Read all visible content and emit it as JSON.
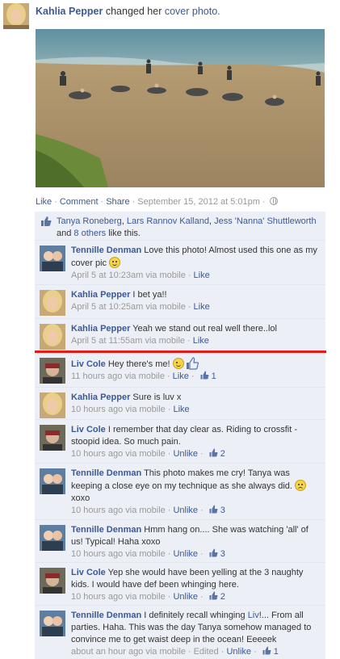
{
  "story": {
    "author": "Kahlia Pepper",
    "verb": "changed her",
    "object": "cover photo."
  },
  "actions": {
    "like": "Like",
    "comment": "Comment",
    "share": "Share",
    "timestamp": "September 15, 2012 at 5:01pm",
    "separator": "·"
  },
  "likes": {
    "names": [
      "Tanya Roneberg",
      "Lars Rannov Kalland",
      "Jess 'Nanna' Shuttleworth"
    ],
    "joiner1": ", ",
    "joiner2": ", ",
    "and": "and",
    "others": "8 others",
    "suffix": "like this."
  },
  "comments": [
    {
      "author": "Tennille Denman",
      "text": "Love this photo! Almost used this one as my cover pic",
      "emoticon": "smile",
      "time": "April 5 at 10:23am via mobile",
      "action": "Like"
    },
    {
      "author": "Kahlia Pepper",
      "text": "I bet ya!!",
      "time": "April 5 at 10:25am via mobile",
      "action": "Like"
    },
    {
      "author": "Kahlia Pepper",
      "text": "Yeah we stand out real well there..lol",
      "time": "April 5 at 11:55am via mobile",
      "action": "Like"
    },
    {
      "author": "Liv Cole",
      "text": "Hey there's me!",
      "emoticon": "wink",
      "time": "11 hours ago via mobile",
      "action": "Like",
      "likes": "1"
    },
    {
      "author": "Kahlia Pepper",
      "text": "Sure is luv x",
      "time": "10 hours ago via mobile",
      "action": "Like"
    },
    {
      "author": "Liv Cole",
      "text": "I remember that day clear as. Riding to crossfit - stoopid idea. So much pain.",
      "time": "10 hours ago via mobile",
      "action": "Unlike",
      "likes": "2"
    },
    {
      "author": "Tennille Denman",
      "text": "This photo makes me cry! Tanya was keeping a close eye on my technique as she always did.",
      "emoticon": "frown",
      "text2": "xoxo",
      "time": "10 hours ago via mobile",
      "action": "Unlike",
      "likes": "3"
    },
    {
      "author": "Tennille Denman",
      "text": "Hmm hang on.... She was watching 'all' of us! Typical! Haha xoxo",
      "time": "10 hours ago via mobile",
      "action": "Unlike",
      "likes": "3"
    },
    {
      "author": "Liv Cole",
      "text": "Yep she would have been yelling at the 3 naughty kids. I would have def been whinging here.",
      "time": "10 hours ago via mobile",
      "action": "Unlike",
      "likes": "2"
    },
    {
      "author": "Tennille Denman",
      "text_pre": "I definitely recall whinging",
      "mention": "Liv",
      "text": "!... From all parties. Haha. This was the day Tanya somehow managed to convince me to get waist deep in the ocean! Eeeeek",
      "time": "about an hour ago via mobile",
      "edited": "Edited",
      "action": "Unlike",
      "likes": "1"
    }
  ],
  "colors": {
    "link": "#3b5998",
    "ufi_background": "#eceff5",
    "meta_text": "#999999",
    "highlight_rule": "#e21b1b"
  }
}
